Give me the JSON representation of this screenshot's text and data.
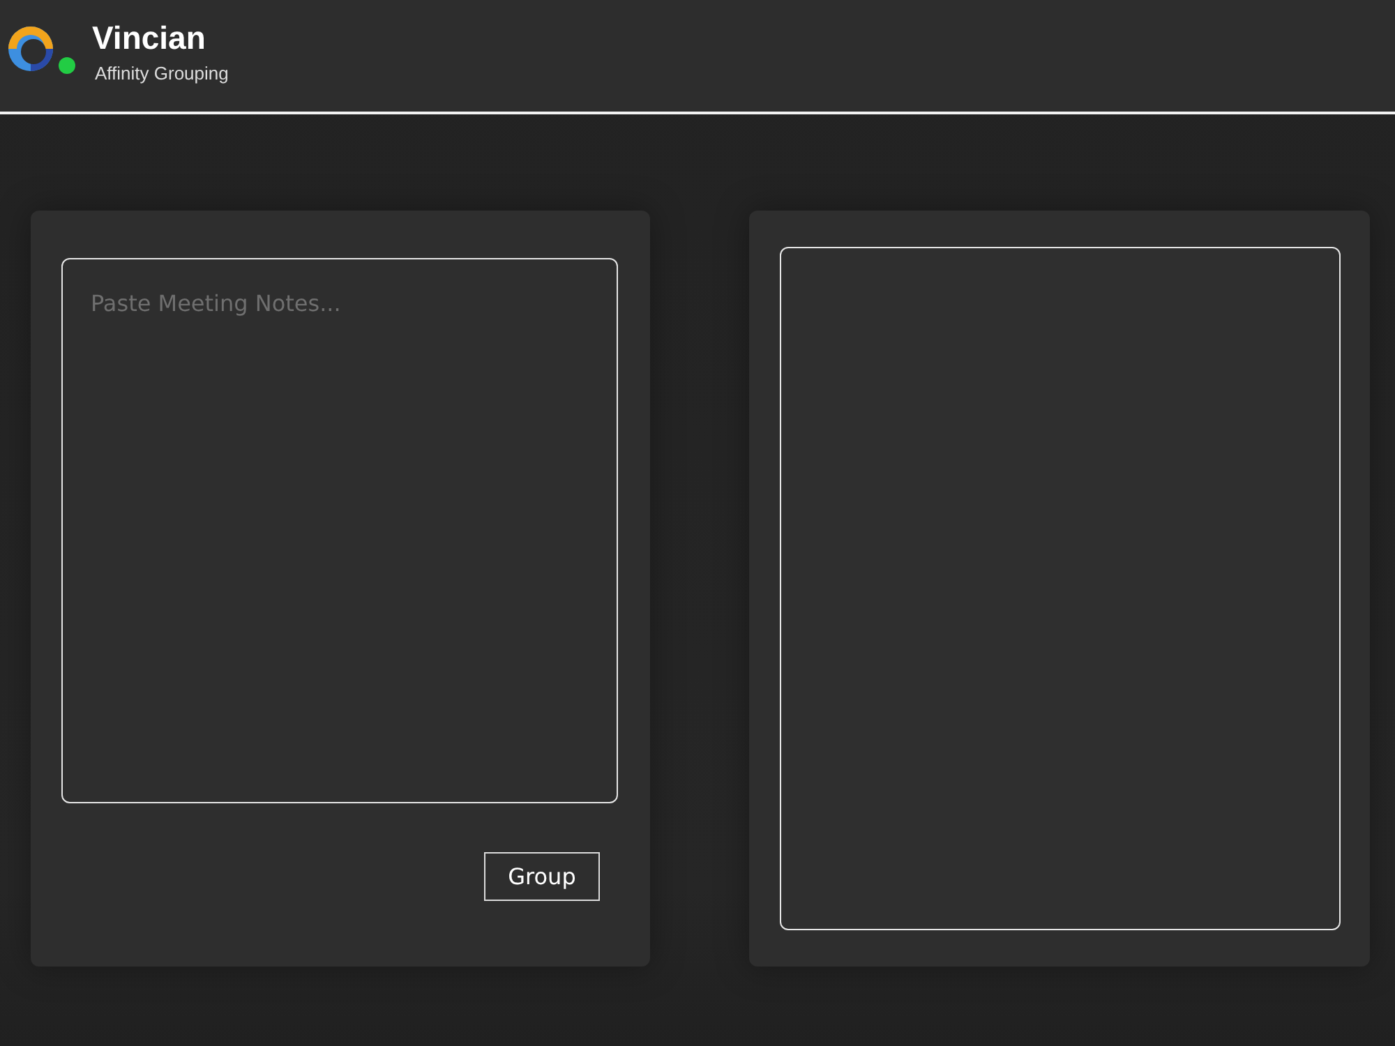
{
  "header": {
    "title": "Vincian",
    "subtitle": "Affinity Grouping"
  },
  "notes_panel": {
    "placeholder": "Paste Meeting Notes...",
    "button": "Group"
  }
}
